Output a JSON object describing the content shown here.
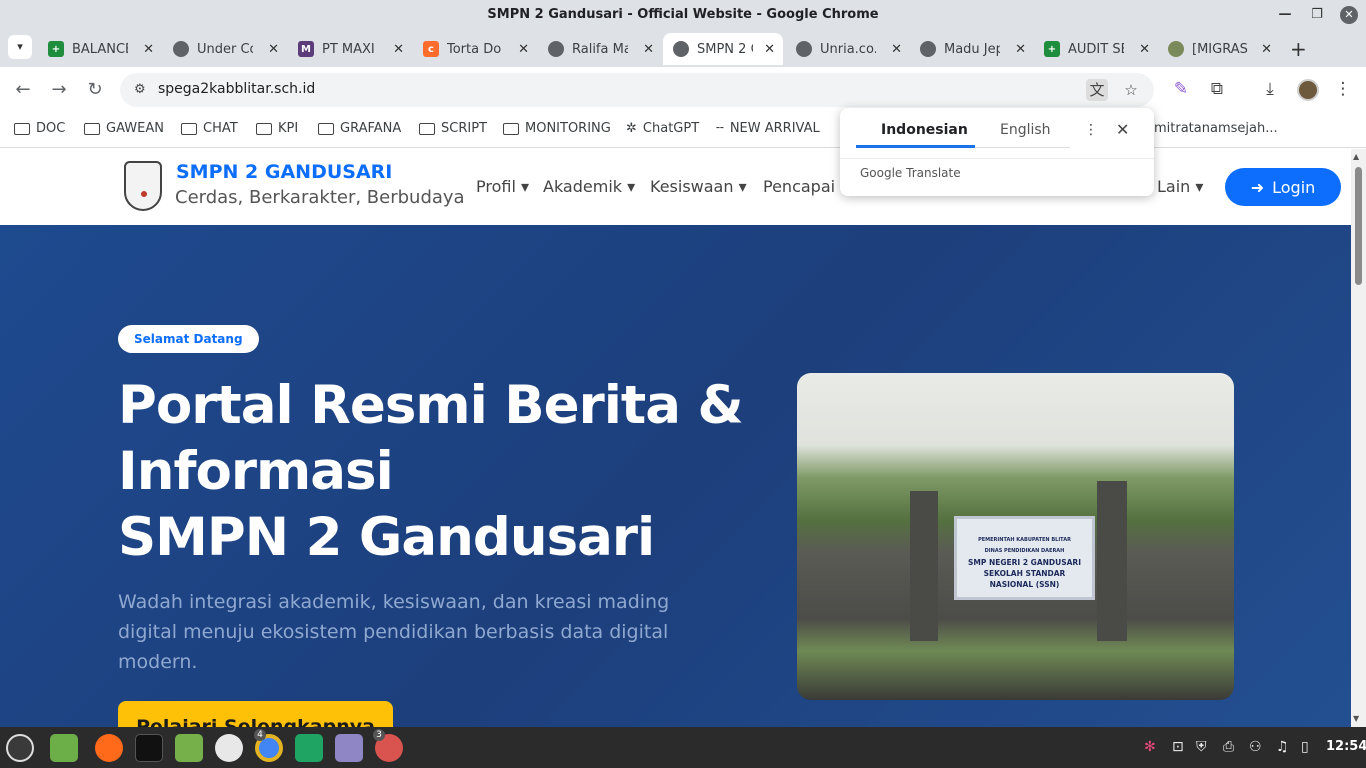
{
  "window": {
    "title": "SMPN 2 Gandusari - Official Website - Google Chrome"
  },
  "tabs": [
    {
      "label": "BALANCE",
      "favicon": "sheets-icon",
      "color": "#1e8e3e"
    },
    {
      "label": "Under Co",
      "favicon": "globe-icon",
      "color": "#5f6368"
    },
    {
      "label": "PT MAXI",
      "favicon": "m-icon",
      "color": "#5c3d7a"
    },
    {
      "label": "Torta Do",
      "favicon": "cpanel-icon",
      "color": "#ff6c2c"
    },
    {
      "label": "Ralifa Ma",
      "favicon": "globe-icon",
      "color": "#5f6368"
    },
    {
      "label": "SMPN 2 G",
      "favicon": "globe-icon",
      "color": "#5f6368",
      "active": true
    },
    {
      "label": "Unria.co.",
      "favicon": "globe-icon",
      "color": "#5f6368"
    },
    {
      "label": "Madu Jep",
      "favicon": "globe-icon",
      "color": "#5f6368"
    },
    {
      "label": "AUDIT SE",
      "favicon": "sheets-icon",
      "color": "#1e8e3e"
    },
    {
      "label": "[MIGRAS",
      "favicon": "bug-icon",
      "color": "#7a8a5a"
    }
  ],
  "toolbar": {
    "url": "spega2kabblitar.sch.id"
  },
  "bookmarks": [
    {
      "label": "DOC",
      "icon": "folder-icon"
    },
    {
      "label": "GAWEAN",
      "icon": "folder-icon"
    },
    {
      "label": "CHAT",
      "icon": "folder-icon"
    },
    {
      "label": "KPI",
      "icon": "folder-icon"
    },
    {
      "label": "GRAFANA",
      "icon": "folder-icon"
    },
    {
      "label": "SCRIPT",
      "icon": "folder-icon"
    },
    {
      "label": "MONITORING",
      "icon": "folder-icon"
    },
    {
      "label": "ChatGPT",
      "icon": "openai-icon"
    },
    {
      "label": "NEW ARRIVAL",
      "icon": "dash-icon"
    },
    {
      "label": "mitratanamsejah...",
      "icon": "globe-icon"
    }
  ],
  "translate_popup": {
    "tab_active": "Indonesian",
    "tab_other": "English",
    "brand": "Google Translate"
  },
  "site": {
    "brand": "SMPN 2 GANDUSARI",
    "tagline": "Cerdas, Berkarakter, Berbudaya",
    "menu": [
      "Profil",
      "Akademik",
      "Kesiswaan",
      "Pencapai",
      "Lain"
    ],
    "login": "Login",
    "hero": {
      "badge": "Selamat Datang",
      "title_line1": "Portal Resmi Berita &",
      "title_line2": "Informasi",
      "title_line3": "SMPN 2 Gandusari",
      "lead": "Wadah integrasi akademik, kesiswaan, dan kreasi mading digital menuju ekosistem pendidikan berbasis data digital modern.",
      "cta": "Pelajari Selengkapnya",
      "sign_line1": "PEMERINTAH KABUPATEN BLITAR",
      "sign_line2": "DINAS PENDIDIKAN DAERAH",
      "sign_line3": "SMP NEGERI 2 GANDUSARI",
      "sign_line4": "SEKOLAH STANDAR NASIONAL (SSN)"
    }
  },
  "taskbar": {
    "clock": "12:54",
    "badge_chrome": "4",
    "badge_app": "3"
  }
}
